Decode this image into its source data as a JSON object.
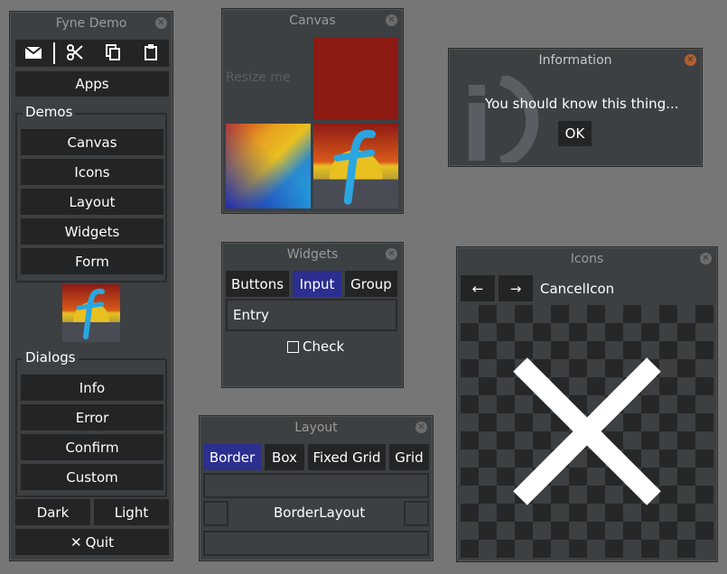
{
  "fyne_demo": {
    "title": "Fyne Demo",
    "apps_label": "Apps",
    "demos_group": "Demos",
    "demos": [
      "Canvas",
      "Icons",
      "Layout",
      "Widgets",
      "Form"
    ],
    "dialogs_group": "Dialogs",
    "dialogs": [
      "Info",
      "Error",
      "Confirm",
      "Custom"
    ],
    "dark_label": "Dark",
    "light_label": "Light",
    "quit_label": "Quit",
    "toolbar_icons": [
      "mail-icon",
      "cut-icon",
      "copy-icon",
      "paste-icon"
    ]
  },
  "canvas_win": {
    "title": "Canvas",
    "faint_text": "Resize me",
    "red_color": "#8e1a14"
  },
  "info_dialog": {
    "title": "Information",
    "message": "You should know this thing...",
    "ok_label": "OK"
  },
  "widgets_win": {
    "title": "Widgets",
    "tabs": [
      "Buttons",
      "Input",
      "Group"
    ],
    "selected_tab": "Input",
    "entry_text": "Entry",
    "check_label": "Check"
  },
  "layout_win": {
    "title": "Layout",
    "tabs": [
      "Border",
      "Box",
      "Fixed Grid",
      "Grid"
    ],
    "selected_tab": "Border",
    "center_label": "BorderLayout"
  },
  "icons_win": {
    "title": "Icons",
    "icon_name": "CancelIcon"
  },
  "colors": {
    "background": "#767676",
    "window": "#3c4043",
    "button": "#222426",
    "selected": "#2b2f8f",
    "close_hot": "#b65f2f"
  }
}
